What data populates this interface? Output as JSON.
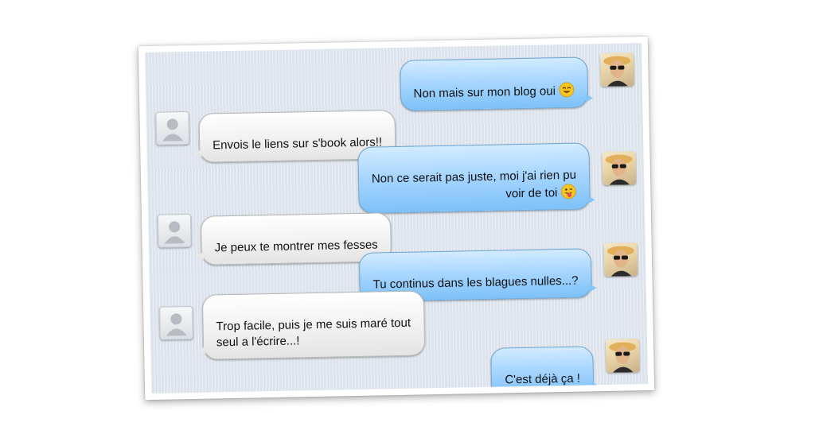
{
  "conversation": {
    "messages": [
      {
        "sender": "me",
        "text": "Non mais sur mon blog oui",
        "emoji": "smiling-face-icon"
      },
      {
        "sender": "other",
        "text": "Envois le liens sur s'book alors!!"
      },
      {
        "sender": "me",
        "text": "Non ce serait pas juste, moi j'ai rien pu\nvoir de toi",
        "emoji": "tongue-out-face-icon"
      },
      {
        "sender": "other",
        "text": "Je peux te montrer mes fesses"
      },
      {
        "sender": "me",
        "text": "Tu continus dans les blagues nulles...?"
      },
      {
        "sender": "other",
        "text": "Trop facile, puis je me suis maré tout\nseul a l'écrire...!"
      },
      {
        "sender": "me",
        "text": "C'est déjà ça !"
      }
    ]
  },
  "colors": {
    "me_bubble": "#a8d6ff",
    "other_bubble": "#f1f1f1",
    "thread_background": "#dde3ec"
  }
}
